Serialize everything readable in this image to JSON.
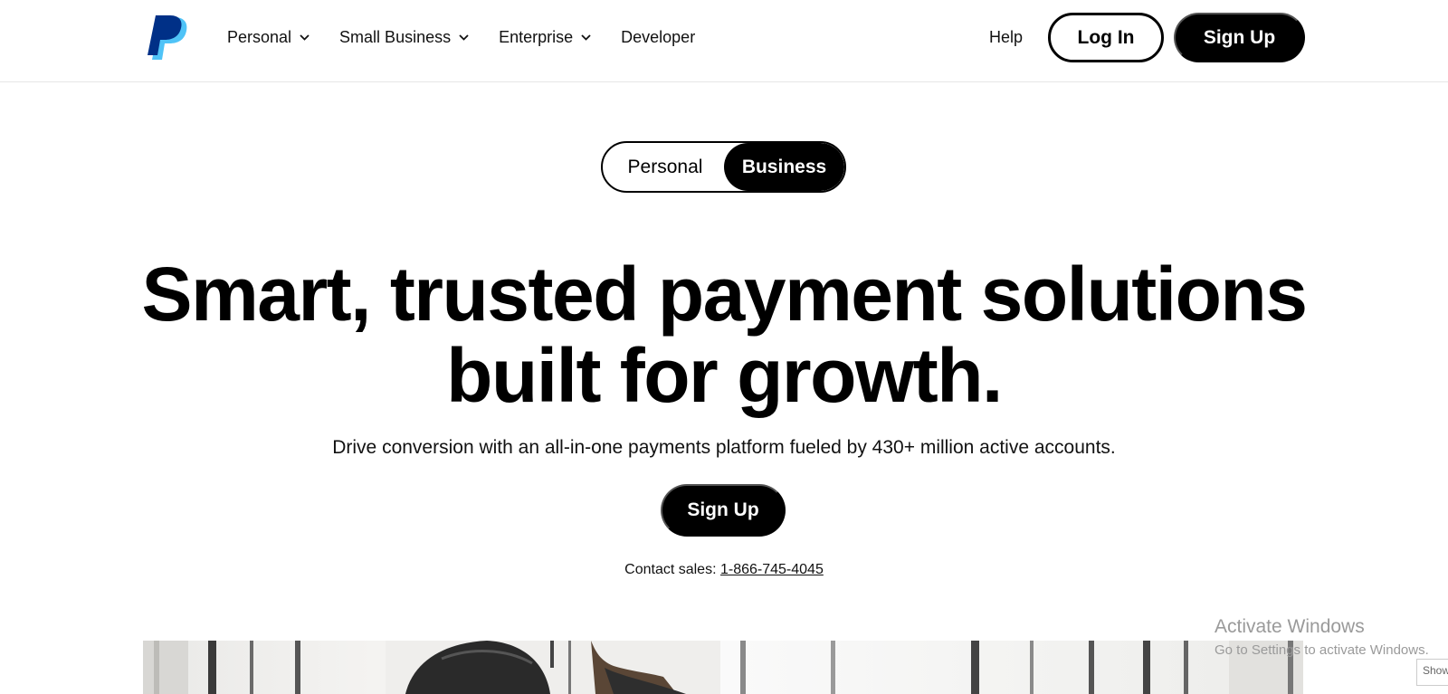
{
  "header": {
    "nav": [
      {
        "label": "Personal",
        "has_dropdown": true
      },
      {
        "label": "Small Business",
        "has_dropdown": true
      },
      {
        "label": "Enterprise",
        "has_dropdown": true
      },
      {
        "label": "Developer",
        "has_dropdown": false
      }
    ],
    "help": "Help",
    "login": "Log In",
    "signup": "Sign Up",
    "logo_icon": "paypal-logo"
  },
  "toggle": {
    "personal": "Personal",
    "business": "Business",
    "selected": "Business"
  },
  "hero": {
    "title_line1": "Smart, trusted payment solutions",
    "title_line2": "built for growth.",
    "subtitle": "Drive conversion with an all-in-one payments platform fueled by 430+ million active accounts.",
    "cta": "Sign Up",
    "contact_label": "Contact sales: ",
    "contact_phone": "1-866-745-4045"
  },
  "watermark": {
    "line1": "Activate Windows",
    "line2": "Go to Settings to activate Windows.",
    "shortcut": "Show"
  },
  "colors": {
    "primary": "#000000",
    "background": "#ffffff",
    "logo_dark": "#003087",
    "logo_light": "#4fc3f7"
  }
}
